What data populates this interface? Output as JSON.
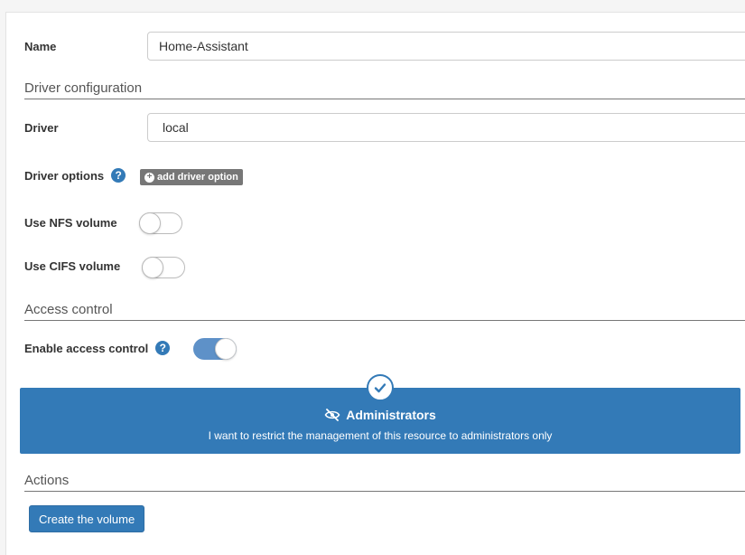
{
  "form": {
    "name_label": "Name",
    "name_value": "Home-Assistant",
    "driver_section": "Driver configuration",
    "driver_label": "Driver",
    "driver_value": "local",
    "driver_options_label": "Driver options",
    "help_glyph": "?",
    "add_driver_option": "add driver option",
    "nfs_label": "Use NFS volume",
    "nfs_enabled": false,
    "cifs_label": "Use CIFS volume",
    "cifs_enabled": false
  },
  "access": {
    "section": "Access control",
    "enable_label": "Enable access control",
    "enabled": true,
    "option_title": "Administrators",
    "option_description": "I want to restrict the management of this resource to administrators only",
    "option_selected": true
  },
  "actions": {
    "section": "Actions",
    "create_button": "Create the volume"
  },
  "colors": {
    "primary": "#337ab7",
    "toggle_on": "#5e91c8",
    "badge": "#777777"
  },
  "icons": {
    "help": "question-circle-icon",
    "add": "plus-circle-icon",
    "selected": "check-circle-icon",
    "administrators": "eye-slash-icon"
  }
}
